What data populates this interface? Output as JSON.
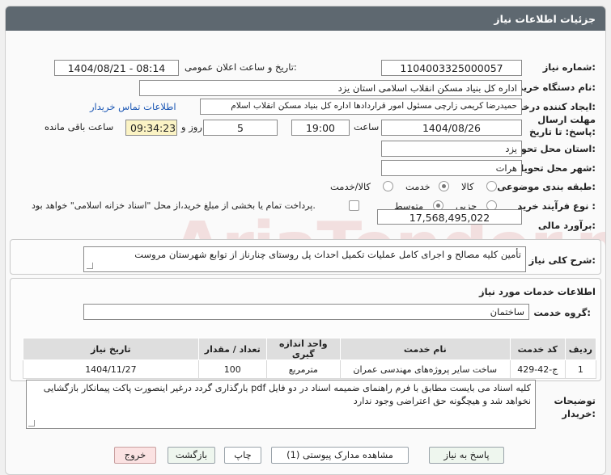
{
  "header": {
    "title": "جزئیات اطلاعات نیاز"
  },
  "labels": {
    "need_number": "شماره نیاز:",
    "announce_datetime": "تاریخ و ساعت اعلان عمومی:",
    "buyer_org": "نام دستگاه خریدار:",
    "requester": "ایجاد کننده درخواست:",
    "deadline": "مهلت ارسال پاسخ: تا تاریخ:",
    "hour": "ساعت",
    "day_and": "روز و",
    "remaining": "ساعت باقی مانده",
    "province": "استان محل تحویل:",
    "city": "شهر محل تحویل:",
    "category": "طبقه بندی موضوعی:",
    "process_type": "نوع فرآیند خرید :",
    "estimate": "برآورد مالی:",
    "overall_desc": "شرح کلی نیاز:",
    "services_info": "اطلاعات خدمات مورد نیاز",
    "service_group": "گروه خدمت:",
    "buyer_notes": "توضیحات خریدار:"
  },
  "values": {
    "need_number": "1104003325000057",
    "announce_datetime": "1404/08/21 - 08:14",
    "buyer_org": "اداره کل بنیاد مسکن انقلاب اسلامی استان یزد",
    "requester": "حمیدرضا کریمی زارچی مسئول امور قراردادها اداره کل بنیاد مسکن انقلاب اسلام",
    "contact_link": "اطلاعات تماس خریدار",
    "deadline_date": "1404/08/26",
    "deadline_time": "19:00",
    "days_left": "5",
    "time_left": "09:34:23",
    "province": "یزد",
    "city": "هرات",
    "estimate": "17,568,495,022",
    "overall_desc": "تأمین کلیه مصالح و اجرای کامل عملیات تکمیل احداث پل روستای چنارناز از توابع شهرستان مروست",
    "service_group": "ساختمان",
    "buyer_notes": "کلیه اسناد می بایست مطابق با فرم راهنمای ضمیمه اسناد در دو فایل pdf بارگذاری گردد درغیر اینصورت  پاکت پیمانکار بازگشایی نخواهد شد و هیچگونه حق اعتراضی وجود ندارد"
  },
  "category_options": {
    "goods": "کالا",
    "service": "خدمت",
    "goods_service": "کالا/خدمت",
    "selected": "service"
  },
  "process_options": {
    "partial": "جزیی",
    "medium": "متوسط",
    "selected": "medium"
  },
  "payment_note": "پرداخت تمام یا بخشی از مبلغ خرید،از محل \"اسناد خزانه اسلامی\" خواهد بود.",
  "table": {
    "headers": [
      "ردیف",
      "کد خدمت",
      "نام خدمت",
      "واحد اندازه گیری",
      "تعداد / مقدار",
      "تاریخ نیاز"
    ],
    "rows": [
      [
        "1",
        "ج-42-429",
        "ساخت سایر پروژه‌های مهندسی عمران",
        "مترمربع",
        "100",
        "1404/11/27"
      ]
    ]
  },
  "buttons": {
    "reply": "پاسخ به نیاز",
    "view_docs": "مشاهده مدارک پیوستی (1)",
    "print": "چاپ",
    "back": "بازگشت",
    "exit": "خروج"
  },
  "watermark": "AriaTender.net",
  "colors": {
    "header_bg": "#5e6870",
    "link": "#1a56b4",
    "highlight": "#fbf3c4"
  }
}
